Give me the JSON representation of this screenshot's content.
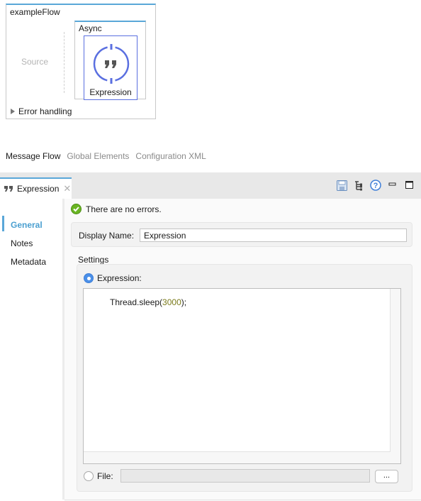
{
  "canvas": {
    "flow_title": "exampleFlow",
    "source_label": "Source",
    "scope_title": "Async",
    "node_label": "Expression",
    "node_icon": "quote-icon",
    "error_handling_label": "Error handling"
  },
  "editor_tabs": [
    {
      "label": "Message Flow",
      "active": true
    },
    {
      "label": "Global Elements",
      "active": false
    },
    {
      "label": "Configuration XML",
      "active": false
    }
  ],
  "properties_view": {
    "tab_label": "Expression",
    "tab_icon": "quote-icon",
    "tools": [
      "save-icon",
      "tree-icon",
      "help-icon",
      "minimize-icon",
      "maximize-icon"
    ],
    "side_nav": [
      {
        "label": "General",
        "active": true
      },
      {
        "label": "Notes",
        "active": false
      },
      {
        "label": "Metadata",
        "active": false
      }
    ],
    "status_text": "There are no errors.",
    "display_name_label": "Display Name:",
    "display_name_value": "Expression",
    "settings_label": "Settings",
    "expression_radio_label": "Expression:",
    "expression_selected": true,
    "code": {
      "prefix": "Thread.sleep(",
      "number": "3000",
      "suffix": ");"
    },
    "file_radio_label": "File:",
    "file_value": "",
    "browse_label": "..."
  },
  "colors": {
    "accent": "#5aa7d8",
    "node_border": "#5a6fe0",
    "active_nav": "#4a9fd0",
    "success": "#6ab523"
  }
}
